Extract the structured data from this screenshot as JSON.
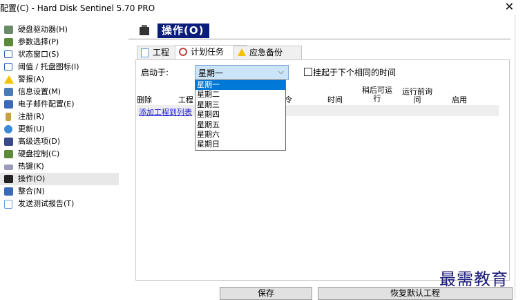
{
  "window": {
    "title": "配置(C)  -  Hard Disk Sentinel 5.70 PRO",
    "close_glyph": "✕"
  },
  "sidebar": {
    "items": [
      {
        "label": "硬盘驱动器(H)",
        "icon": "disk-drive-icon",
        "color": "#6a8a6a"
      },
      {
        "label": "参数选择(P)",
        "icon": "preferences-icon",
        "color": "#5a8a3a"
      },
      {
        "label": "状态窗口(S)",
        "icon": "status-window-icon",
        "color": "#2a5ab8"
      },
      {
        "label": "阈值 / 托盘图标(I)",
        "icon": "threshold-tray-icon",
        "color": "#2a5ab8"
      },
      {
        "label": "警报(A)",
        "icon": "warning-icon",
        "color": "#f2c200"
      },
      {
        "label": "信息设置(M)",
        "icon": "message-settings-icon",
        "color": "#4a7ab8"
      },
      {
        "label": "电子邮件配置(E)",
        "icon": "email-icon",
        "color": "#3a6ab8"
      },
      {
        "label": "注册(R)",
        "icon": "register-icon",
        "color": "#c8a040"
      },
      {
        "label": "更新(U)",
        "icon": "update-globe-icon",
        "color": "#3a8ad8"
      },
      {
        "label": "高级选项(D)",
        "icon": "advanced-options-icon",
        "color": "#3a4a8a"
      },
      {
        "label": "硬盘控制(C)",
        "icon": "disk-control-icon",
        "color": "#5a8a3a"
      },
      {
        "label": "热键(K)",
        "icon": "hotkey-icon",
        "color": "#7a7a9a"
      },
      {
        "label": "操作(O)",
        "icon": "action-clapper-icon",
        "color": "#222222",
        "active": true
      },
      {
        "label": "整合(N)",
        "icon": "integration-icon",
        "color": "#3a6ab8"
      },
      {
        "label": "发送测试报告(T)",
        "icon": "send-report-icon",
        "color": "#6a9ad8"
      }
    ]
  },
  "main": {
    "header_title": "操作(O)",
    "tabs": [
      {
        "label": "工程",
        "icon": "project-icon"
      },
      {
        "label": "计划任务",
        "icon": "schedule-clock-icon",
        "active": true
      },
      {
        "label": "应急备份",
        "icon": "emergency-backup-icon"
      }
    ],
    "start_label": "启动于:",
    "start_value": "星期一",
    "combo_arrow": "⌵",
    "checkbox_label": "挂起于下个相同的时间",
    "columns": {
      "delete": "删除",
      "project": "工程",
      "partial": "令",
      "time": "时间",
      "retry_line1": "稍后可运",
      "retry_line2": "行",
      "before_line1": "运行前询",
      "before_line2": "问",
      "enabled": "启用"
    },
    "add_link": "添加工程到列表",
    "dropdown_options": [
      "星期一",
      "星期二",
      "星期三",
      "星期四",
      "星期五",
      "星期六",
      "星期日"
    ],
    "buttons": {
      "save": "保存",
      "restore": "恢复默认工程"
    }
  },
  "watermark": "最需教育"
}
